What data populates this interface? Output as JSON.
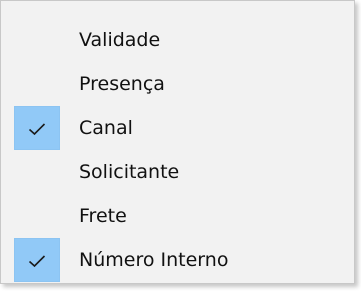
{
  "menu": {
    "items": [
      {
        "label": "Validade",
        "checked": false
      },
      {
        "label": "Presença",
        "checked": false
      },
      {
        "label": "Canal",
        "checked": true
      },
      {
        "label": "Solicitante",
        "checked": false
      },
      {
        "label": "Frete",
        "checked": false
      },
      {
        "label": "Número Interno",
        "checked": true
      }
    ],
    "check_highlight_color": "#91c9f7",
    "icon": "checkmark-icon"
  }
}
